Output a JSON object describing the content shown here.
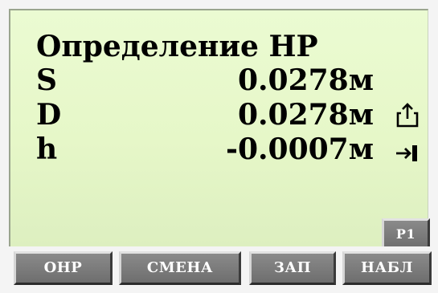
{
  "screen": {
    "title": "Определение HP",
    "rows": [
      {
        "label": "S",
        "value": "0.0278м"
      },
      {
        "label": "D",
        "value": "0.0278м"
      },
      {
        "label": "h",
        "value": "-0.0007м"
      }
    ],
    "icons": [
      "share-icon",
      "tab-arrow-icon"
    ]
  },
  "page_button": {
    "label": "P1"
  },
  "softkeys": [
    {
      "label": "OHP"
    },
    {
      "label": "СМЕНА"
    },
    {
      "label": "ЗАП"
    },
    {
      "label": "НАБЛ"
    }
  ],
  "colors": {
    "screen_background": "#e6f7c8",
    "softkey_background": "#7a7a7a",
    "text": "#000000",
    "softkey_text": "#ffffff"
  }
}
